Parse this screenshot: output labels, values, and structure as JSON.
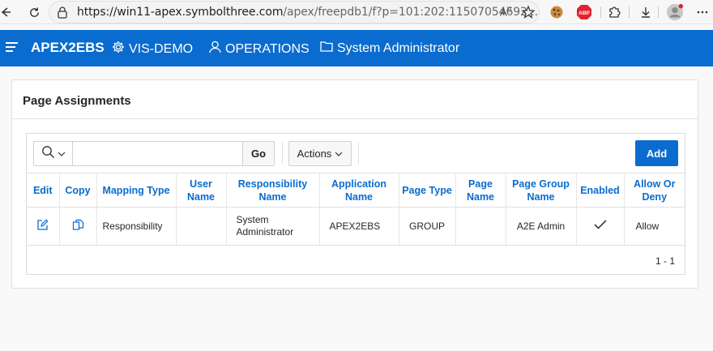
{
  "browser": {
    "url_host": "https://win11-apex.symbolthree.com",
    "url_path": "/apex/freepdb1/f?p=101:202:11507054692...",
    "read_aloud": "A",
    "abp_label": "ABP"
  },
  "header": {
    "brand": "APEX2EBS",
    "nav": [
      {
        "label": "VIS-DEMO",
        "icon": "gear-icon"
      },
      {
        "label": "OPERATIONS",
        "icon": "user-icon"
      },
      {
        "label": "System Administrator",
        "icon": "folder-icon"
      }
    ],
    "color": "#0a6cce"
  },
  "region": {
    "title": "Page Assignments"
  },
  "toolbar": {
    "search_value": "",
    "go_label": "Go",
    "actions_label": "Actions",
    "add_label": "Add"
  },
  "table": {
    "columns": [
      "Edit",
      "Copy",
      "Mapping Type",
      "User Name",
      "Responsibility Name",
      "Application Name",
      "Page Type",
      "Page Name",
      "Page Group Name",
      "Enabled",
      "Allow Or Deny"
    ],
    "rows": [
      {
        "mapping_type": "Responsibility",
        "user_name": "",
        "responsibility_name": "System Administrator",
        "application_name": "APEX2EBS",
        "page_type": "GROUP",
        "page_name": "",
        "page_group_name": "A2E Admin",
        "enabled": true,
        "allow_or_deny": "Allow"
      }
    ]
  },
  "pagination": "1 - 1"
}
